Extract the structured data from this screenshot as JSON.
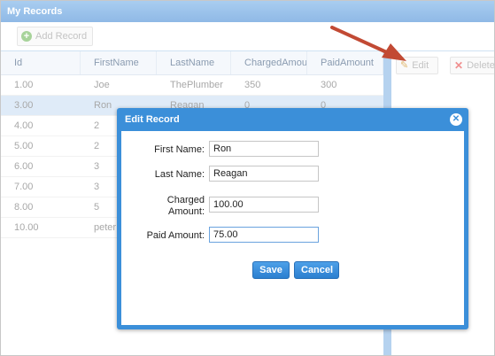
{
  "window": {
    "title": "My Records"
  },
  "toolbar": {
    "add_label": "Add Record"
  },
  "side_toolbar": {
    "edit_label": "Edit",
    "delete_label": "Delete"
  },
  "grid": {
    "columns": [
      "Id",
      "FirstName",
      "LastName",
      "ChargedAmount",
      "PaidAmount"
    ],
    "rows": [
      [
        "1.00",
        "Joe",
        "ThePlumber",
        "350",
        "300"
      ],
      [
        "3.00",
        "Ron",
        "Reagan",
        "0",
        "0"
      ],
      [
        "4.00",
        "2",
        "",
        "",
        ""
      ],
      [
        "5.00",
        "2",
        "",
        "",
        ""
      ],
      [
        "6.00",
        "3",
        "",
        "",
        ""
      ],
      [
        "7.00",
        "3",
        "",
        "",
        ""
      ],
      [
        "8.00",
        "5",
        "",
        "",
        ""
      ],
      [
        "10.00",
        "peter",
        "",
        "",
        ""
      ]
    ],
    "selected_row": 1
  },
  "dialog": {
    "title": "Edit Record",
    "first_name": {
      "label": "First Name:",
      "value": "Ron"
    },
    "last_name": {
      "label": "Last Name:",
      "value": "Reagan"
    },
    "charged_amount": {
      "label_line1": "Charged",
      "label_line2": "Amount:",
      "value": "100.00"
    },
    "paid_amount": {
      "label": "Paid Amount:",
      "value": "75.00"
    },
    "save_label": "Save",
    "cancel_label": "Cancel"
  },
  "icons": {
    "add": "add-icon",
    "edit": "pencil-icon",
    "delete": "delete-icon",
    "close": "close-icon",
    "annotation": "red-arrow"
  },
  "colors": {
    "titlebar": "#9ec4ec",
    "dialog_header": "#3b8fd9",
    "button": "#3a8fdd",
    "selected_row": "#dfebf8",
    "arrow": "#c24a34"
  }
}
